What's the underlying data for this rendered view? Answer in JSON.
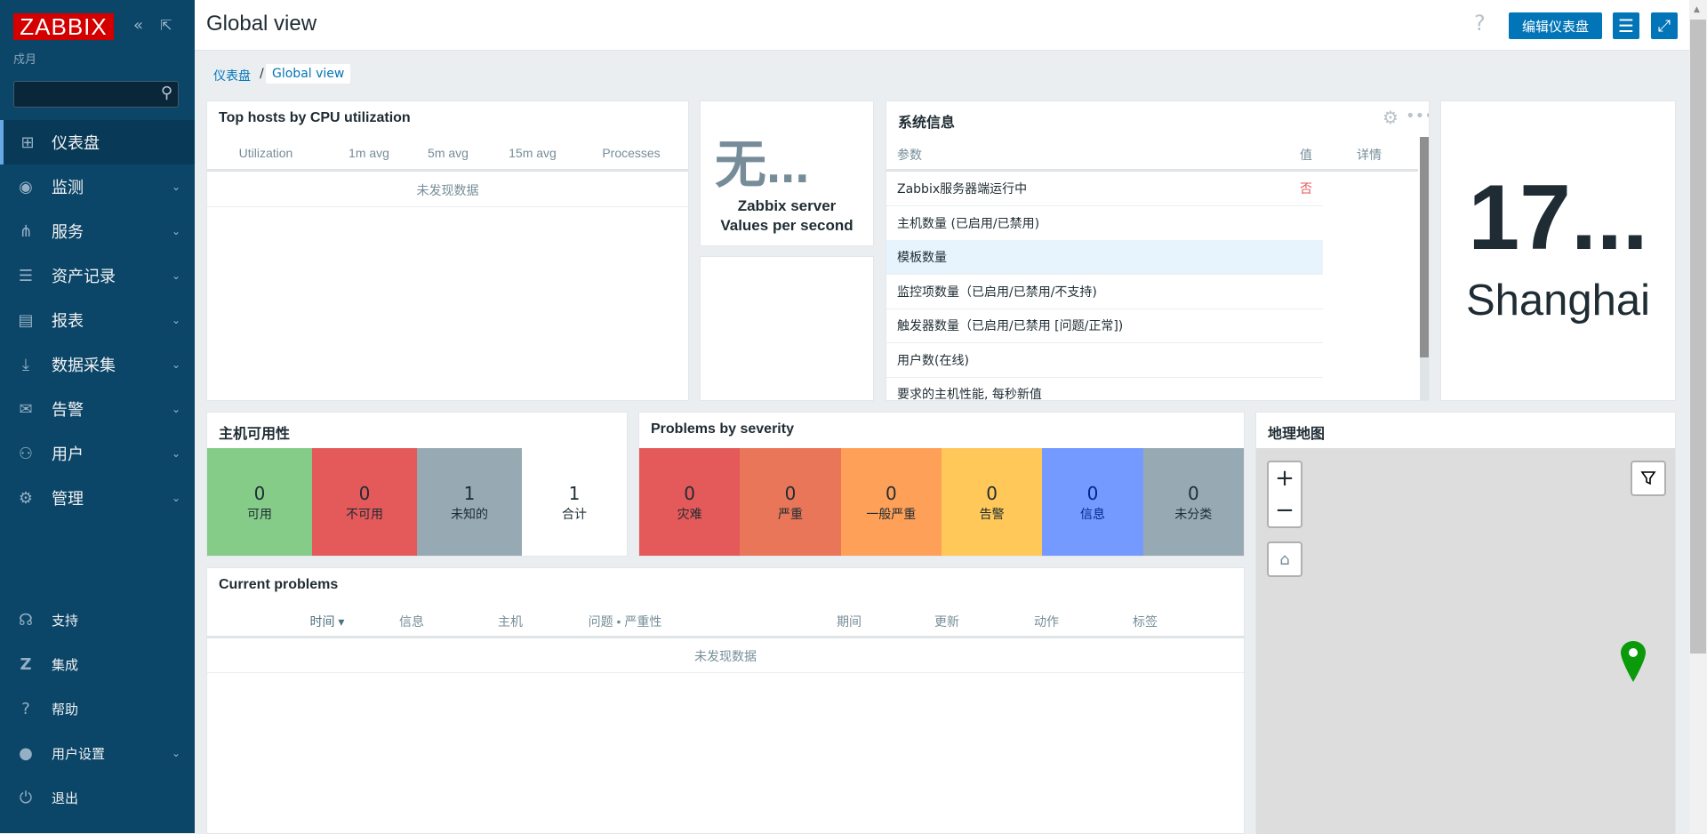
{
  "sidebar": {
    "logo": "ZABBIX",
    "username": "戍月",
    "search_placeholder": "",
    "items": [
      {
        "label": "仪表盘"
      },
      {
        "label": "监测"
      },
      {
        "label": "服务"
      },
      {
        "label": "资产记录"
      },
      {
        "label": "报表"
      },
      {
        "label": "数据采集"
      },
      {
        "label": "告警"
      },
      {
        "label": "用户"
      },
      {
        "label": "管理"
      }
    ],
    "bottom": [
      {
        "label": "支持"
      },
      {
        "label": "集成"
      },
      {
        "label": "帮助"
      },
      {
        "label": "用户设置"
      },
      {
        "label": "退出"
      }
    ]
  },
  "header": {
    "title": "Global view",
    "help": "?",
    "edit_label": "编辑仪表盘"
  },
  "breadcrumb": {
    "root": "仪表盘",
    "sep": "/",
    "current": "Global view"
  },
  "top_hosts": {
    "title": "Top hosts by CPU utilization",
    "columns": [
      "Utilization",
      "1m avg",
      "5m avg",
      "15m avg",
      "Processes"
    ],
    "empty": "未发现数据"
  },
  "item_value": {
    "value": "无...",
    "line1": "Zabbix server",
    "line2": "Values per second"
  },
  "sysinfo": {
    "title": "系统信息",
    "columns": [
      "参数",
      "值",
      "详情"
    ],
    "rows": [
      {
        "param": "Zabbix服务器端运行中",
        "value": "否"
      },
      {
        "param": "主机数量 (已启用/已禁用)",
        "value": ""
      },
      {
        "param": "模板数量",
        "value": ""
      },
      {
        "param": "监控项数量（已启用/已禁用/不支持)",
        "value": ""
      },
      {
        "param": "触发器数量（已启用/已禁用 [问题/正常])",
        "value": ""
      },
      {
        "param": "用户数(在线)",
        "value": ""
      },
      {
        "param": "要求的主机性能, 每秒新值",
        "value": ""
      }
    ]
  },
  "clock": {
    "time": "17...",
    "city": "Shanghai"
  },
  "host_avail": {
    "title": "主机可用性",
    "cells": [
      {
        "count": "0",
        "label": "可用",
        "color": "#86cc89"
      },
      {
        "count": "0",
        "label": "不可用",
        "color": "#e45959"
      },
      {
        "count": "1",
        "label": "未知的",
        "color": "#97aab3"
      },
      {
        "count": "1",
        "label": "合计",
        "color": "#ffffff"
      }
    ]
  },
  "severity": {
    "title": "Problems by severity",
    "cells": [
      {
        "count": "0",
        "label": "灾难",
        "color": "#e45959"
      },
      {
        "count": "0",
        "label": "严重",
        "color": "#e97659"
      },
      {
        "count": "0",
        "label": "一般严重",
        "color": "#ffa059"
      },
      {
        "count": "0",
        "label": "告警",
        "color": "#ffc859"
      },
      {
        "count": "0",
        "label": "信息",
        "color": "#7499ff"
      },
      {
        "count": "0",
        "label": "未分类",
        "color": "#97aab3"
      }
    ]
  },
  "current_problems": {
    "title": "Current problems",
    "columns": [
      "时间 ▾",
      "信息",
      "主机",
      "问题 • 严重性",
      "期间",
      "更新",
      "动作",
      "标签"
    ],
    "empty": "未发现数据"
  },
  "geomap": {
    "title": "地理地图",
    "zoom_in": "+",
    "zoom_out": "−"
  }
}
